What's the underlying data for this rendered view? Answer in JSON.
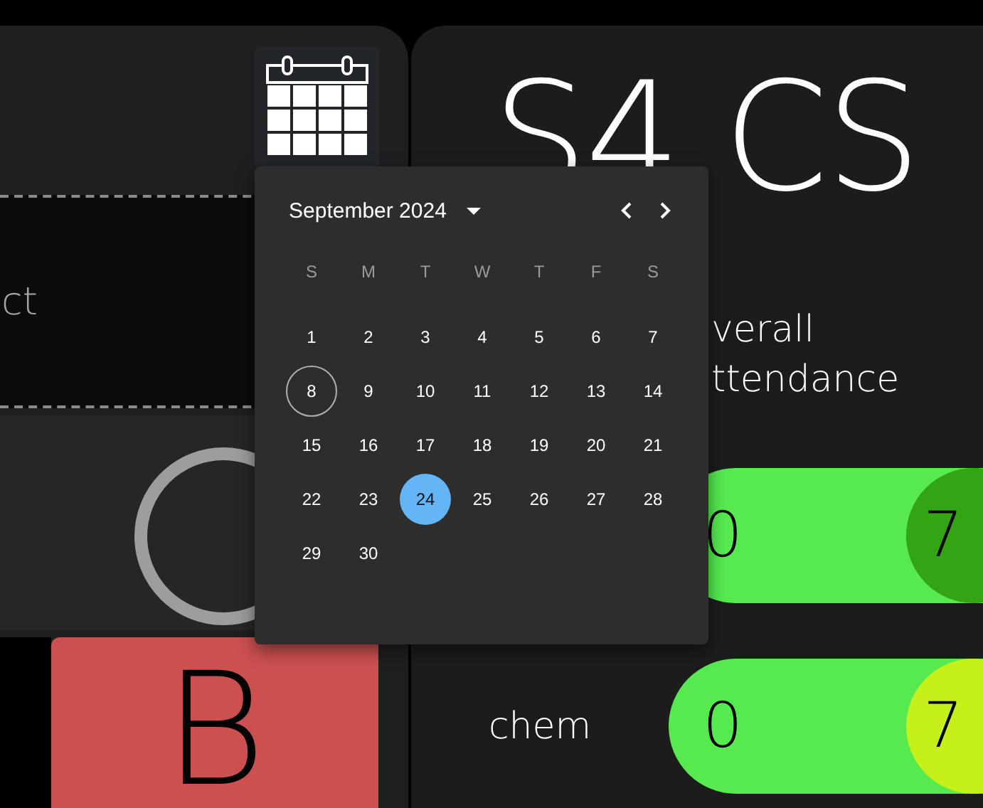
{
  "left_panel": {
    "subject_hint": "ct",
    "grade_card": {
      "letter": "B"
    }
  },
  "class_panel": {
    "title": "S4 CS",
    "overall_label": [
      "verall",
      "ttendance"
    ],
    "subjects": [
      {
        "value": "0",
        "threshold": "7",
        "color": "#33a514"
      },
      {
        "name": "chem",
        "value": "0",
        "threshold": "7",
        "color": "#c5f01a"
      }
    ]
  },
  "date_picker": {
    "month_label": "September 2024",
    "weekdays": [
      "S",
      "M",
      "T",
      "W",
      "T",
      "F",
      "S"
    ],
    "days": [
      {
        "label": "1",
        "selected": false,
        "today": false
      },
      {
        "label": "2",
        "selected": false,
        "today": false
      },
      {
        "label": "3",
        "selected": false,
        "today": false
      },
      {
        "label": "4",
        "selected": false,
        "today": false
      },
      {
        "label": "5",
        "selected": false,
        "today": false
      },
      {
        "label": "6",
        "selected": false,
        "today": false
      },
      {
        "label": "7",
        "selected": false,
        "today": false
      },
      {
        "label": "8",
        "selected": false,
        "today": true
      },
      {
        "label": "9",
        "selected": false,
        "today": false
      },
      {
        "label": "10",
        "selected": false,
        "today": false
      },
      {
        "label": "11",
        "selected": false,
        "today": false
      },
      {
        "label": "12",
        "selected": false,
        "today": false
      },
      {
        "label": "13",
        "selected": false,
        "today": false
      },
      {
        "label": "14",
        "selected": false,
        "today": false
      },
      {
        "label": "15",
        "selected": false,
        "today": false
      },
      {
        "label": "16",
        "selected": false,
        "today": false
      },
      {
        "label": "17",
        "selected": false,
        "today": false
      },
      {
        "label": "18",
        "selected": false,
        "today": false
      },
      {
        "label": "19",
        "selected": false,
        "today": false
      },
      {
        "label": "20",
        "selected": false,
        "today": false
      },
      {
        "label": "21",
        "selected": false,
        "today": false
      },
      {
        "label": "22",
        "selected": false,
        "today": false
      },
      {
        "label": "23",
        "selected": false,
        "today": false
      },
      {
        "label": "24",
        "selected": true,
        "today": false
      },
      {
        "label": "25",
        "selected": false,
        "today": false
      },
      {
        "label": "26",
        "selected": false,
        "today": false
      },
      {
        "label": "27",
        "selected": false,
        "today": false
      },
      {
        "label": "28",
        "selected": false,
        "today": false
      },
      {
        "label": "29",
        "selected": false,
        "today": false
      },
      {
        "label": "30",
        "selected": false,
        "today": false
      }
    ]
  }
}
